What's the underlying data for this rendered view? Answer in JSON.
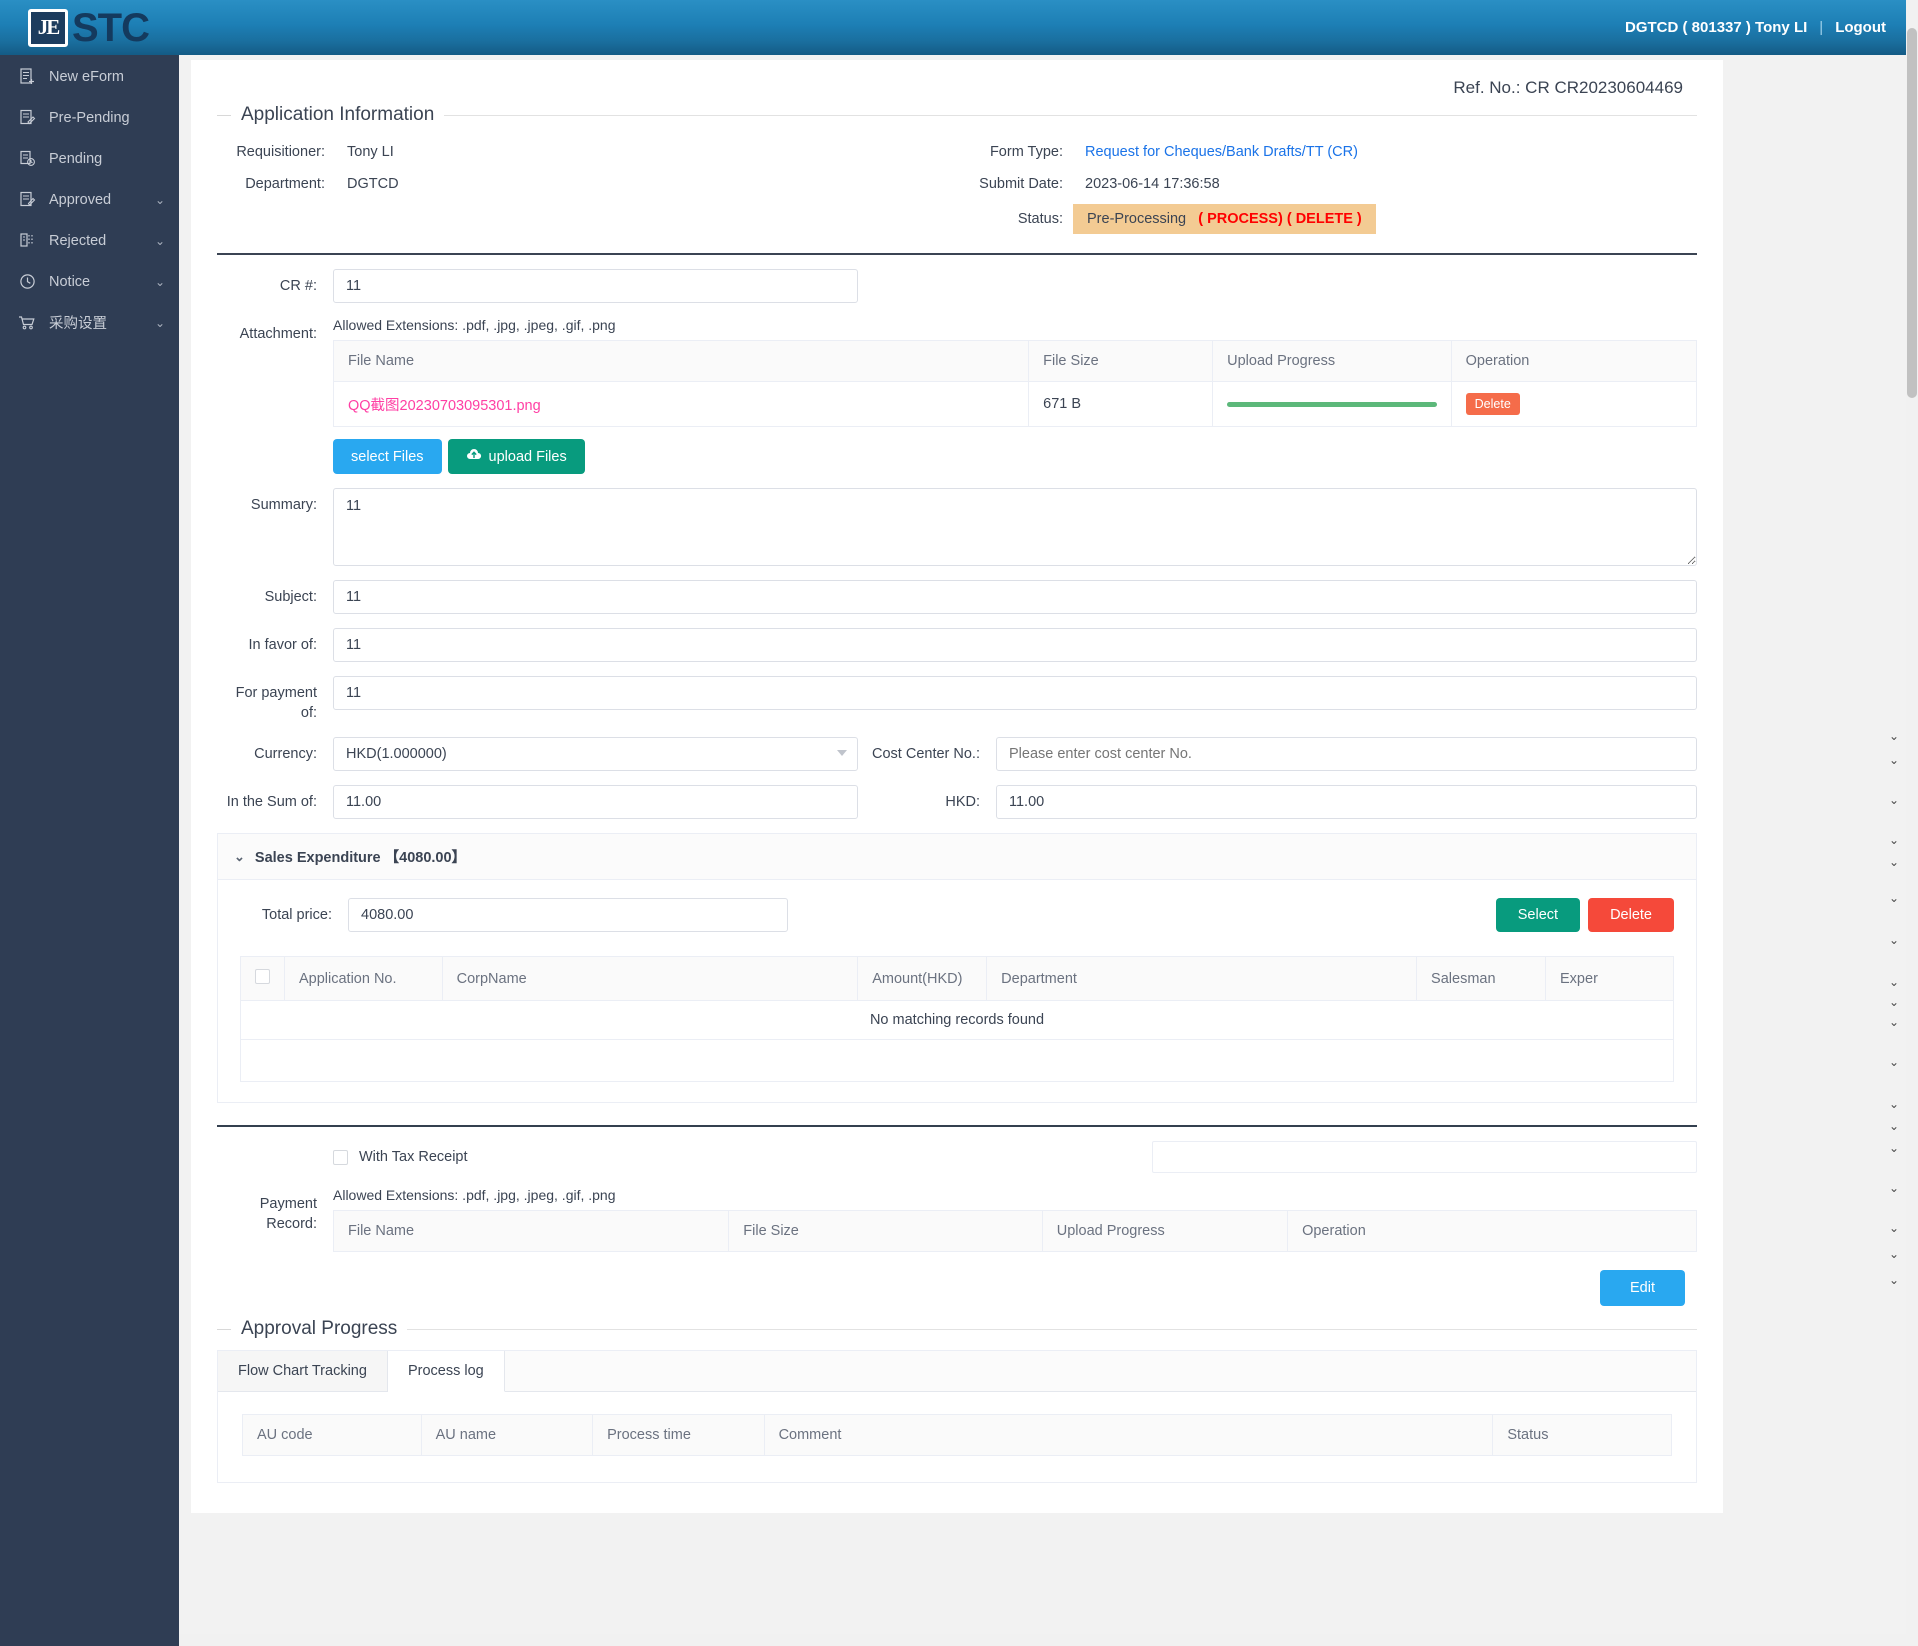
{
  "topbar": {
    "logo_mark": "JE",
    "logo_text": "STC",
    "user_info": "DGTCD ( 801337 ) Tony LI",
    "divider": "|",
    "logout_label": "Logout"
  },
  "sidebar": {
    "items": [
      {
        "label": "New eForm",
        "icon": "document-plus-icon",
        "caret": ""
      },
      {
        "label": "Pre-Pending",
        "icon": "document-edit-icon",
        "caret": ""
      },
      {
        "label": "Pending",
        "icon": "document-clock-icon",
        "caret": ""
      },
      {
        "label": "Approved",
        "icon": "document-check-icon",
        "caret": "⌄"
      },
      {
        "label": "Rejected",
        "icon": "document-reject-icon",
        "caret": "⌄"
      },
      {
        "label": "Notice",
        "icon": "clock-icon",
        "caret": "⌄"
      },
      {
        "label": "采购设置",
        "icon": "cart-icon",
        "caret": "⌄"
      }
    ]
  },
  "page": {
    "ref_no": "Ref. No.: CR CR20230604469",
    "section_application": "Application Information",
    "section_approval": "Approval Progress"
  },
  "application_info": {
    "requisitioner_label": "Requisitioner:",
    "requisitioner_value": "Tony LI",
    "department_label": "Department:",
    "department_value": "DGTCD",
    "form_type_label": "Form Type:",
    "form_type_value": "Request for Cheques/Bank Drafts/TT (CR)",
    "submit_date_label": "Submit Date:",
    "submit_date_value": "2023-06-14 17:36:58",
    "status_label": "Status:",
    "status_value": "Pre-Processing",
    "status_process": "( PROCESS)",
    "status_delete": "( DELETE )"
  },
  "form": {
    "cr_label": "CR #:",
    "cr_value": "11",
    "attachment_label": "Attachment:",
    "allowed_extensions": "Allowed Extensions: .pdf, .jpg, .jpeg, .gif, .png",
    "summary_label": "Summary:",
    "summary_value": "11",
    "subject_label": "Subject:",
    "subject_value": "11",
    "in_favor_label": "In favor of:",
    "in_favor_value": "11",
    "for_payment_label": "For payment of:",
    "for_payment_value": "11",
    "currency_label": "Currency:",
    "currency_value": "HKD(1.000000)",
    "cost_center_label": "Cost Center No.:",
    "cost_center_value": "",
    "cost_center_placeholder": "Please enter cost center No.",
    "sum_label": "In the Sum of:",
    "sum_value": "11.00",
    "hkd_label": "HKD:",
    "hkd_value": "11.00",
    "select_files_label": "select Files",
    "upload_files_label": "upload Files",
    "upload_icon": "cloud-upload-icon"
  },
  "attachment_table": {
    "headers": [
      "File Name",
      "File Size",
      "Upload Progress",
      "Operation"
    ],
    "rows": [
      {
        "file_name": "QQ截图20230703095301.png",
        "file_size": "671 B",
        "progress_percent": 100,
        "operation_label": "Delete"
      }
    ]
  },
  "sales_expenditure": {
    "title": "Sales Expenditure 【4080.00】",
    "collapse_icon": "chevron-down-icon",
    "total_price_label": "Total price:",
    "total_price_value": "4080.00",
    "select_label": "Select",
    "delete_label": "Delete",
    "headers": [
      "",
      "Application No.",
      "CorpName",
      "Amount(HKD)",
      "Department",
      "Salesman",
      "Exper"
    ],
    "empty_message": "No matching records found"
  },
  "tax_section": {
    "checkbox_label": "With Tax Receipt",
    "checked": false,
    "payment_record_label": "Payment Record:",
    "allowed_extensions": "Allowed Extensions: .pdf, .jpg, .jpeg, .gif, .png",
    "headers": [
      "File Name",
      "File Size",
      "Upload Progress",
      "Operation"
    ],
    "edit_label": "Edit"
  },
  "approval_progress": {
    "tabs": [
      {
        "label": "Flow Chart Tracking",
        "active": false
      },
      {
        "label": "Process log",
        "active": true
      }
    ],
    "headers": [
      "AU code",
      "AU name",
      "Process time",
      "Comment",
      "Status"
    ]
  },
  "colors": {
    "topbar": "#1d7fb5",
    "sidebar": "#2f3d54",
    "link": "#1a73e8",
    "status_badge_bg": "#f3cb93",
    "status_action": "#ff0000",
    "file_link": "#ff3fa4",
    "progress_fill": "#5cb87a",
    "btn_blue": "#29a8f0",
    "btn_teal": "#089b7e",
    "btn_red": "#f56c4a",
    "btn_red_large": "#f5493a"
  }
}
